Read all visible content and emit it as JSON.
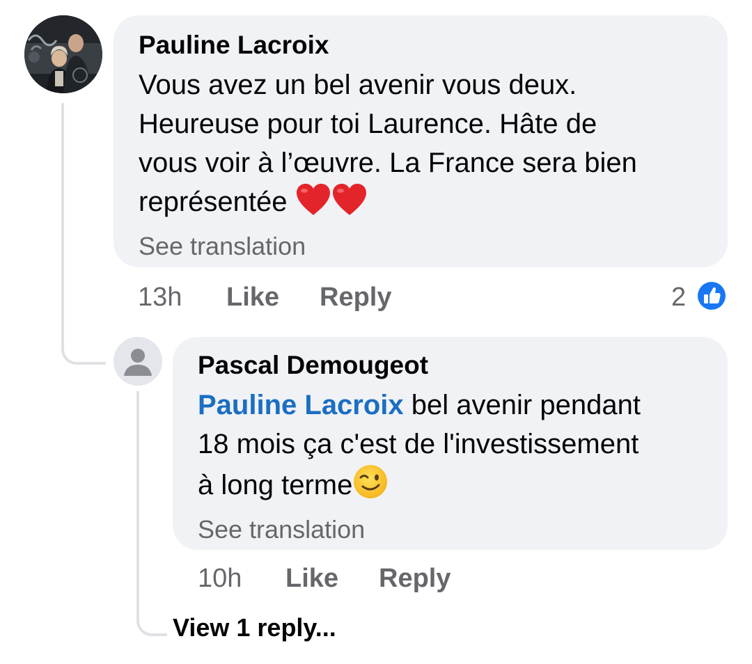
{
  "comments": [
    {
      "author": "Pauline Lacroix",
      "text_lines": [
        "Vous avez un bel avenir vous deux.",
        "Heureuse pour toi Laurence.  Hâte de",
        "vous voir à l’œuvre.  La France sera bien",
        "représentée"
      ],
      "emoji": "red-heart-red-heart",
      "see_translation": "See translation",
      "time": "13h",
      "like_label": "Like",
      "reply_label": "Reply",
      "reaction_count": "2",
      "reaction_icon": "like-thumb-icon",
      "reaction_color": "#1877f2"
    },
    {
      "author": "Pascal Demougeot",
      "mention": "Pauline Lacroix",
      "text_lines": [
        " bel avenir pendant",
        "18 mois ça c'est de l'investissement",
        "à  long terme"
      ],
      "emoji": "winking-face",
      "see_translation": "See translation",
      "time": "10h",
      "like_label": "Like",
      "reply_label": "Reply"
    }
  ],
  "view_replies": "View 1 reply...",
  "colors": {
    "bubble": "#f0f2f5",
    "mention": "#1b6ec2",
    "secondary_text": "#65676b",
    "thread_line": "#dfe1e5"
  }
}
